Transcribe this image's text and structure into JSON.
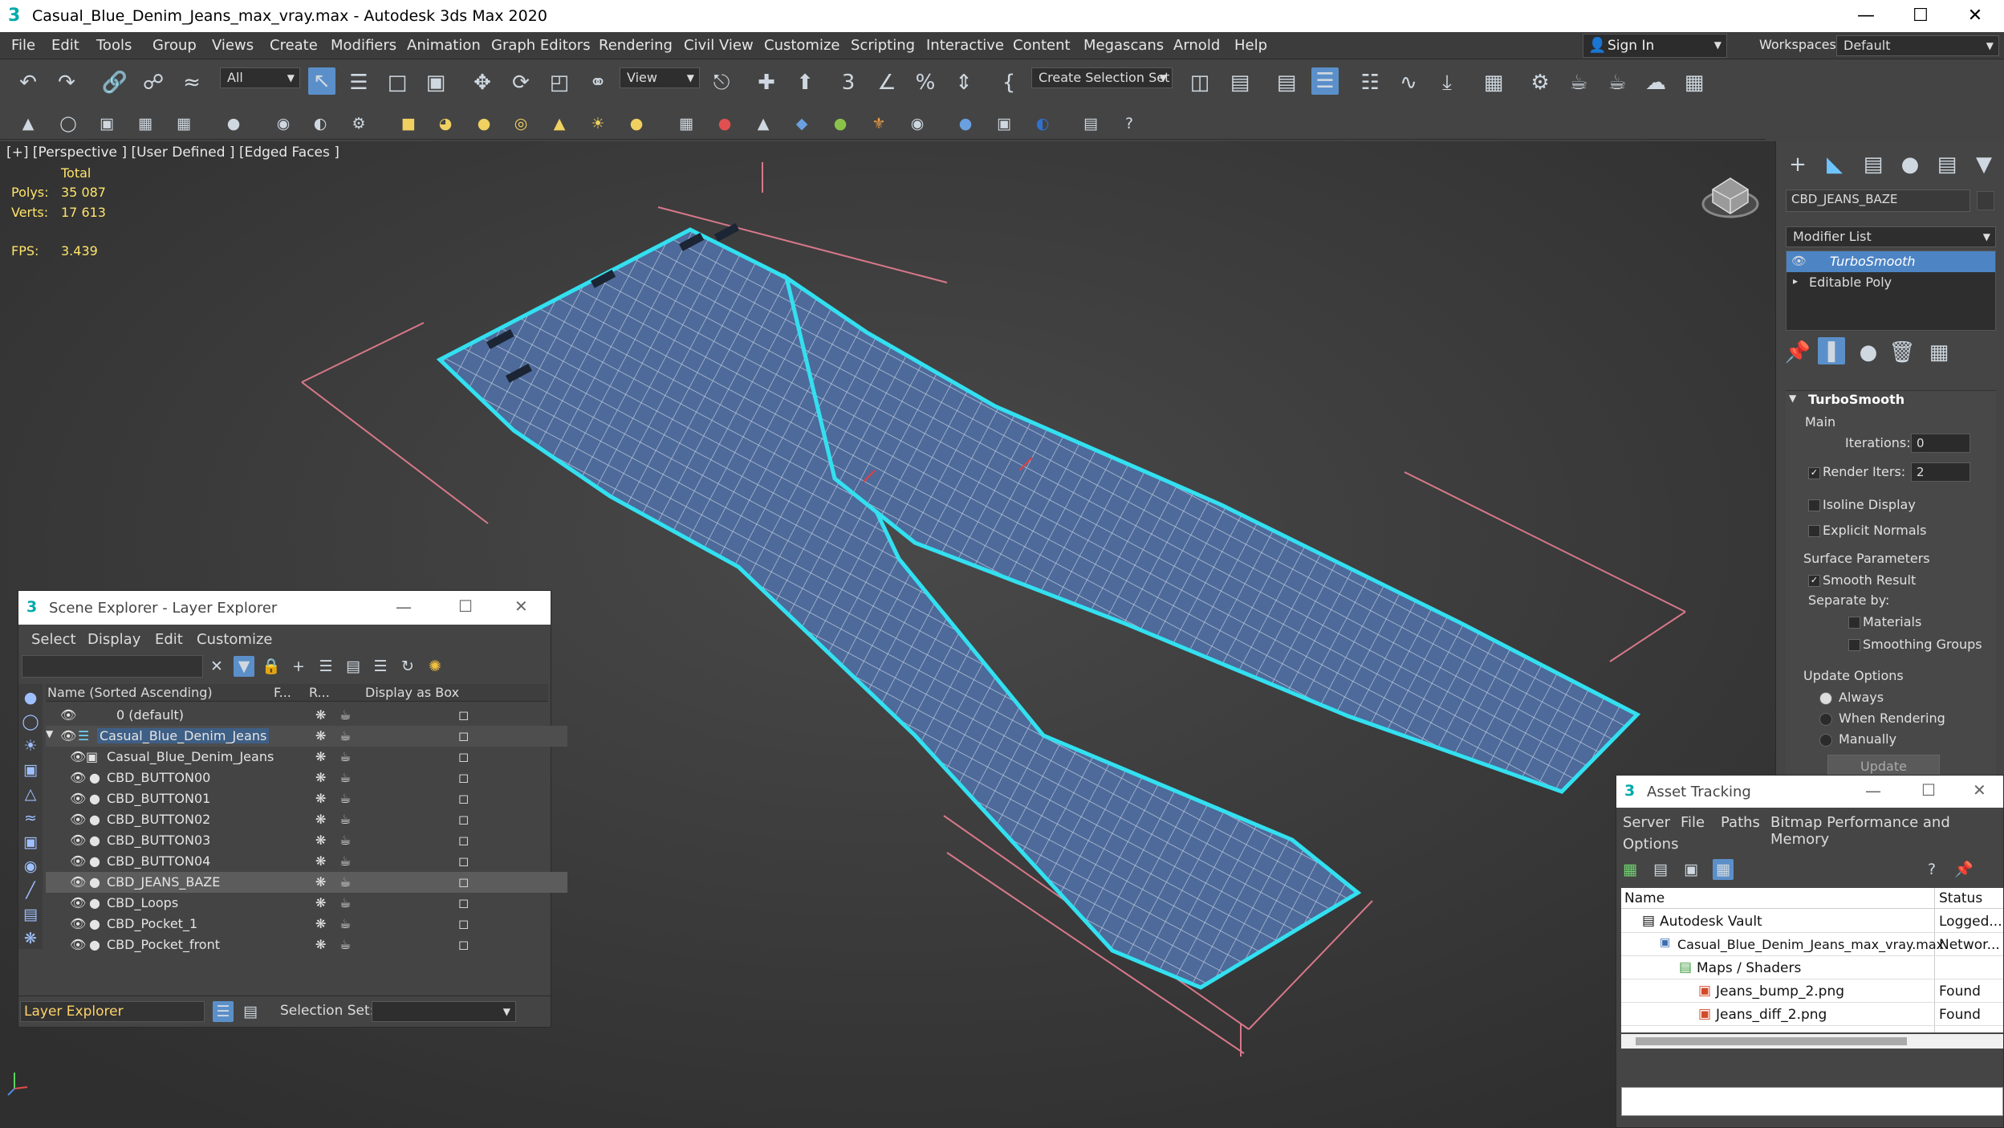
{
  "window": {
    "title": "Casual_Blue_Denim_Jeans_max_vray.max - Autodesk 3ds Max 2020",
    "logo": "3"
  },
  "menu": [
    "File",
    "Edit",
    "Tools",
    "Group",
    "Views",
    "Create",
    "Modifiers",
    "Animation",
    "Graph Editors",
    "Rendering",
    "Civil View",
    "Customize",
    "Scripting",
    "Interactive",
    "Content",
    "Megascans",
    "Arnold",
    "Help"
  ],
  "signin": "Sign In",
  "workspaces": {
    "label": "Workspaces:",
    "value": "Default"
  },
  "toolbar": {
    "filter_value": "All",
    "refcoord_value": "View",
    "selection_set_placeholder": "Create Selection Set"
  },
  "viewport": {
    "label": "[+] [Perspective ] [User Defined ] [Edged Faces ]",
    "stats": {
      "total": "Total",
      "polys_label": "Polys:",
      "polys": "35 087",
      "verts_label": "Verts:",
      "verts": "17 613",
      "fps_label": "FPS:",
      "fps": "3.439"
    }
  },
  "command_panel": {
    "object_name": "CBD_JEANS_BAZE",
    "modifier_list": "Modifier List",
    "stack": [
      "TurboSmooth",
      "Editable Poly"
    ],
    "rollout_title": "TurboSmooth",
    "main_label": "Main",
    "iterations_label": "Iterations:",
    "iterations": "0",
    "render_iters_label": "Render Iters:",
    "render_iters": "2",
    "isoline": "Isoline Display",
    "explicit": "Explicit Normals",
    "surface_params": "Surface Parameters",
    "smooth_result": "Smooth Result",
    "separate_by": "Separate by:",
    "materials": "Materials",
    "smoothing_groups": "Smoothing Groups",
    "update_options": "Update Options",
    "always": "Always",
    "when_rendering": "When Rendering",
    "manually": "Manually",
    "update_button": "Update"
  },
  "scene_explorer": {
    "title": "Scene Explorer - Layer Explorer",
    "menu": [
      "Select",
      "Display",
      "Edit",
      "Customize"
    ],
    "columns": {
      "name": "Name (Sorted Ascending)",
      "f": "F...",
      "r": "R...",
      "box": "Display as Box"
    },
    "rows": [
      "0 (default)",
      "Casual_Blue_Denim_Jeans",
      "Casual_Blue_Denim_Jeans",
      "CBD_BUTTON00",
      "CBD_BUTTON01",
      "CBD_BUTTON02",
      "CBD_BUTTON03",
      "CBD_BUTTON04",
      "CBD_JEANS_BAZE",
      "CBD_Loops",
      "CBD_Pocket_1",
      "CBD_Pocket_front"
    ],
    "footer_layer": "Layer Explorer",
    "selection_set_label": "Selection Set:"
  },
  "asset_tracking": {
    "title": "Asset Tracking",
    "menu": [
      "Server",
      "File",
      "Paths",
      "Bitmap Performance and Memory",
      "Options"
    ],
    "columns": {
      "name": "Name",
      "status": "Status"
    },
    "rows": [
      {
        "name": "Autodesk Vault",
        "status": "Logged..."
      },
      {
        "name": "Casual_Blue_Denim_Jeans_max_vray.max",
        "status": "Networ..."
      },
      {
        "name": "Maps / Shaders",
        "status": ""
      },
      {
        "name": "Jeans_bump_2.png",
        "status": "Found"
      },
      {
        "name": "Jeans_diff_2.png",
        "status": "Found"
      }
    ]
  }
}
